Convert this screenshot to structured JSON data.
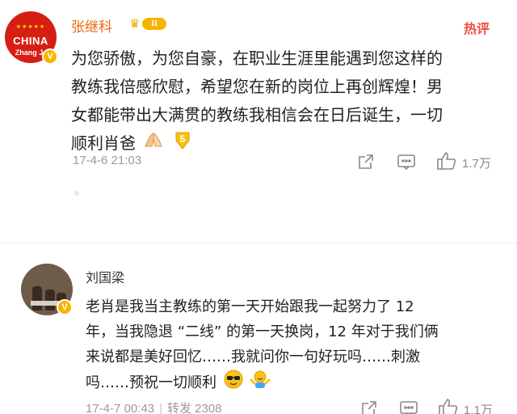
{
  "comments": [
    {
      "username": "张继科",
      "vip_level": "II",
      "hot_label": "热评",
      "avatar_text": {
        "country": "CHINA",
        "name": "Zhang J"
      },
      "text_lines": [
        "为您骄傲，为您自豪，在职业生涯里能遇到您这样的",
        "教练我倍感欣慰，希望您在新的岗位上再创辉煌！男",
        "女都能带出大满贯的教练我相信会在日后诞生，一切",
        "顺利肖爸"
      ],
      "emojis": [
        "pray-hands-emoji",
        "five-emoji"
      ],
      "timestamp": "17-4-6 21:03",
      "like_count": "1.7万"
    },
    {
      "username": "刘国梁",
      "text_lines": [
        "老肖是我当主教练的第一天开始跟我一起努力了 12",
        "年，当我隐退 “二线” 的第一天换岗，12 年对于我们俩",
        "来说都是美好回忆……我就问你一句好玩吗……刺激",
        "吗……预祝一切顺利"
      ],
      "emojis": [
        "sunglasses-emoji",
        "shrug-emoji"
      ],
      "timestamp": "17-4-7 00:43",
      "repost_label": "转发 2308",
      "like_count": "1.1万"
    }
  ],
  "colors": {
    "vip_name": "#e86b0f",
    "hot": "#f24b3b",
    "meta": "#9a9a9a",
    "badge": "#f7b500"
  }
}
